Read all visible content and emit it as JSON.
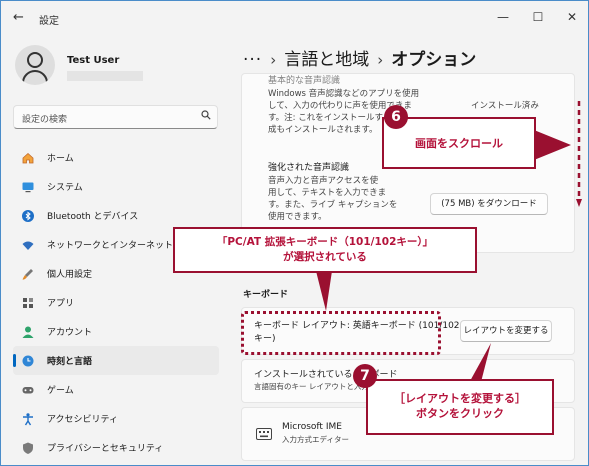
{
  "window": {
    "back_icon": "←",
    "title": "設定",
    "minimize": "—",
    "maximize": "☐",
    "close": "✕"
  },
  "user": {
    "name": "Test User"
  },
  "search": {
    "placeholder": "設定の検索"
  },
  "nav": {
    "home": "ホーム",
    "system": "システム",
    "bluetooth": "Bluetooth とデバイス",
    "network": "ネットワークとインターネット",
    "personalization": "個人用設定",
    "apps": "アプリ",
    "accounts": "アカウント",
    "time_language": "時刻と言語",
    "gaming": "ゲーム",
    "accessibility": "アクセシビリティ",
    "privacy": "プライバシーとセキュリティ"
  },
  "breadcrumb": {
    "dots": "···",
    "sep": "›",
    "parent": "言語と地域",
    "current": "オプション"
  },
  "speech_basic": {
    "title": "基本的な音声認識",
    "desc1": "Windows 音声認識などのアプリを使用",
    "desc2": "して、入力の代わりに声を使用できま",
    "desc3": "す。注: これをインストールすると、",
    "desc4": "成もインストールされます。",
    "status": "インストール済み"
  },
  "speech_enhanced": {
    "title": "強化された音声認識",
    "desc1": "音声入力と音声アクセスを使",
    "desc2": "用して、テキストを入力できま",
    "desc3": "す。また、ライブ キャプションを",
    "desc4": "使用できます。",
    "download": "(75 MB) をダウンロード"
  },
  "keyboard_section": "キーボード",
  "keyboard_layout": {
    "line1": "キーボード レイアウト: 英語キーボード (101/102",
    "line2": "キー)",
    "change_button": "レイアウトを変更する"
  },
  "installed_keyboards": {
    "title": "インストールされているキーボード",
    "desc": "言語固有のキー レイアウトと入力"
  },
  "ime": {
    "name": "Microsoft IME",
    "desc": "入力方式エディター"
  },
  "annotations": {
    "step6_number": "6",
    "step6_text": "画面をスクロール",
    "callout_line1": "「PC/AT 拡張キーボード（101/102キー）」",
    "callout_line2": "が選択されている",
    "step7_number": "7",
    "step7_line1": "［レイアウトを変更する］",
    "step7_line2": "ボタンをクリック"
  },
  "colors": {
    "accent": "#0067c0",
    "annotation": "#9a1030"
  }
}
